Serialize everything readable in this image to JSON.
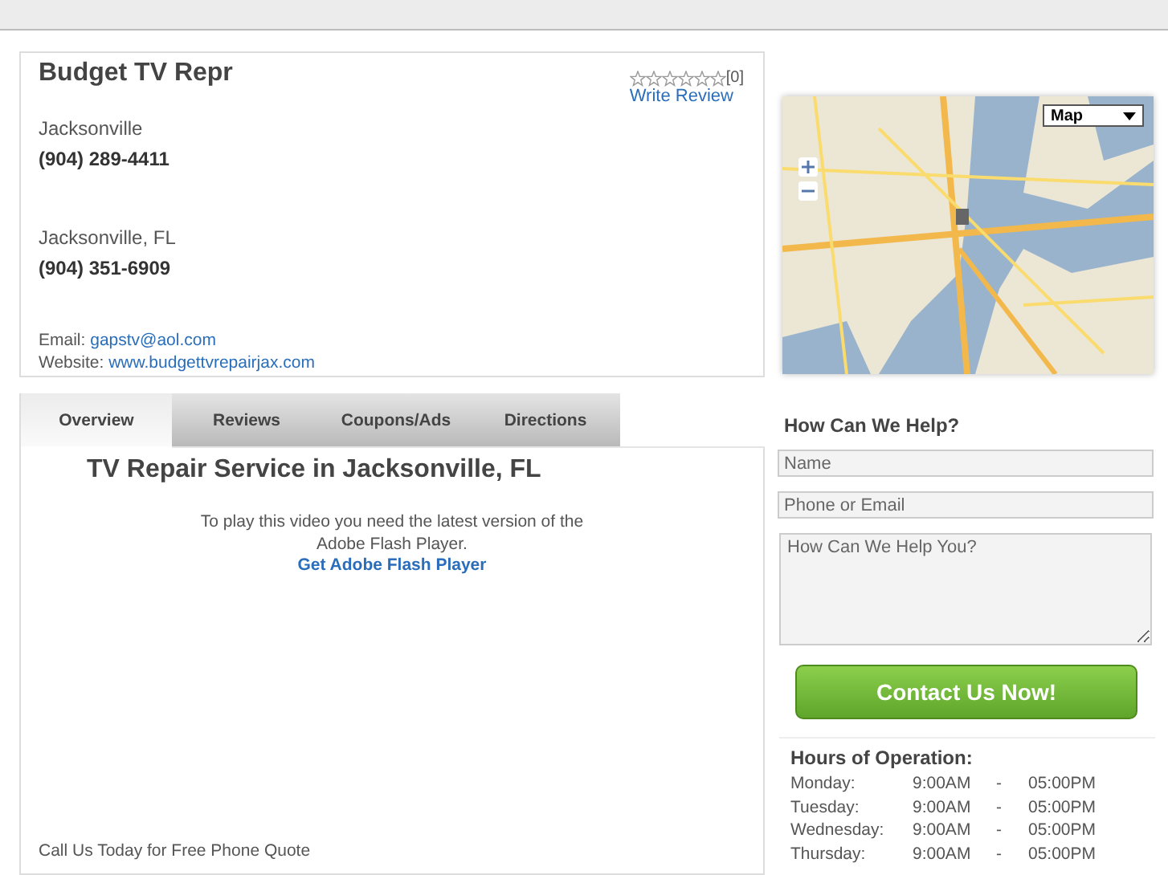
{
  "business": {
    "name": "Budget TV Repr",
    "stars": 0,
    "review_count": "[0]",
    "write_review": "Write Review",
    "locations": [
      {
        "city": "Jacksonville",
        "phone": "(904) 289-4411"
      },
      {
        "city": "Jacksonville, FL",
        "phone": "(904) 351-6909"
      }
    ],
    "email_label": "Email:",
    "email": "gapstv@aol.com",
    "website_label": "Website:",
    "website": "www.budgettvrepairjax.com"
  },
  "tabs": [
    {
      "label": "Overview",
      "selected": true
    },
    {
      "label": "Reviews",
      "selected": false
    },
    {
      "label": "Coupons/Ads",
      "selected": false
    },
    {
      "label": "Directions",
      "selected": false
    }
  ],
  "overview": {
    "heading": "TV Repair Service in Jacksonville, FL",
    "flash_notice": "To play this video you need the latest version of the Adobe Flash Player.",
    "flash_link": "Get Adobe Flash Player",
    "footer": "Call Us Today for Free Phone Quote"
  },
  "map": {
    "kind": "picture",
    "type_select": "Map"
  },
  "contact": {
    "heading": "How Can We Help?",
    "name_placeholder": "Name",
    "phone_placeholder": "Phone or Email",
    "message_placeholder": "How Can We Help You?",
    "submit": "Contact Us Now!"
  },
  "hours": {
    "heading": "Hours of Operation:",
    "rows": [
      {
        "day": "Monday:",
        "open": "9:00AM",
        "dash": "-",
        "close": "05:00PM"
      },
      {
        "day": "Tuesday:",
        "open": "9:00AM",
        "dash": "-",
        "close": "05:00PM"
      },
      {
        "day": "Wednesday:",
        "open": "9:00AM",
        "dash": "-",
        "close": "05:00PM"
      },
      {
        "day": "Thursday:",
        "open": "9:00AM",
        "dash": "-",
        "close": "05:00PM"
      }
    ]
  }
}
